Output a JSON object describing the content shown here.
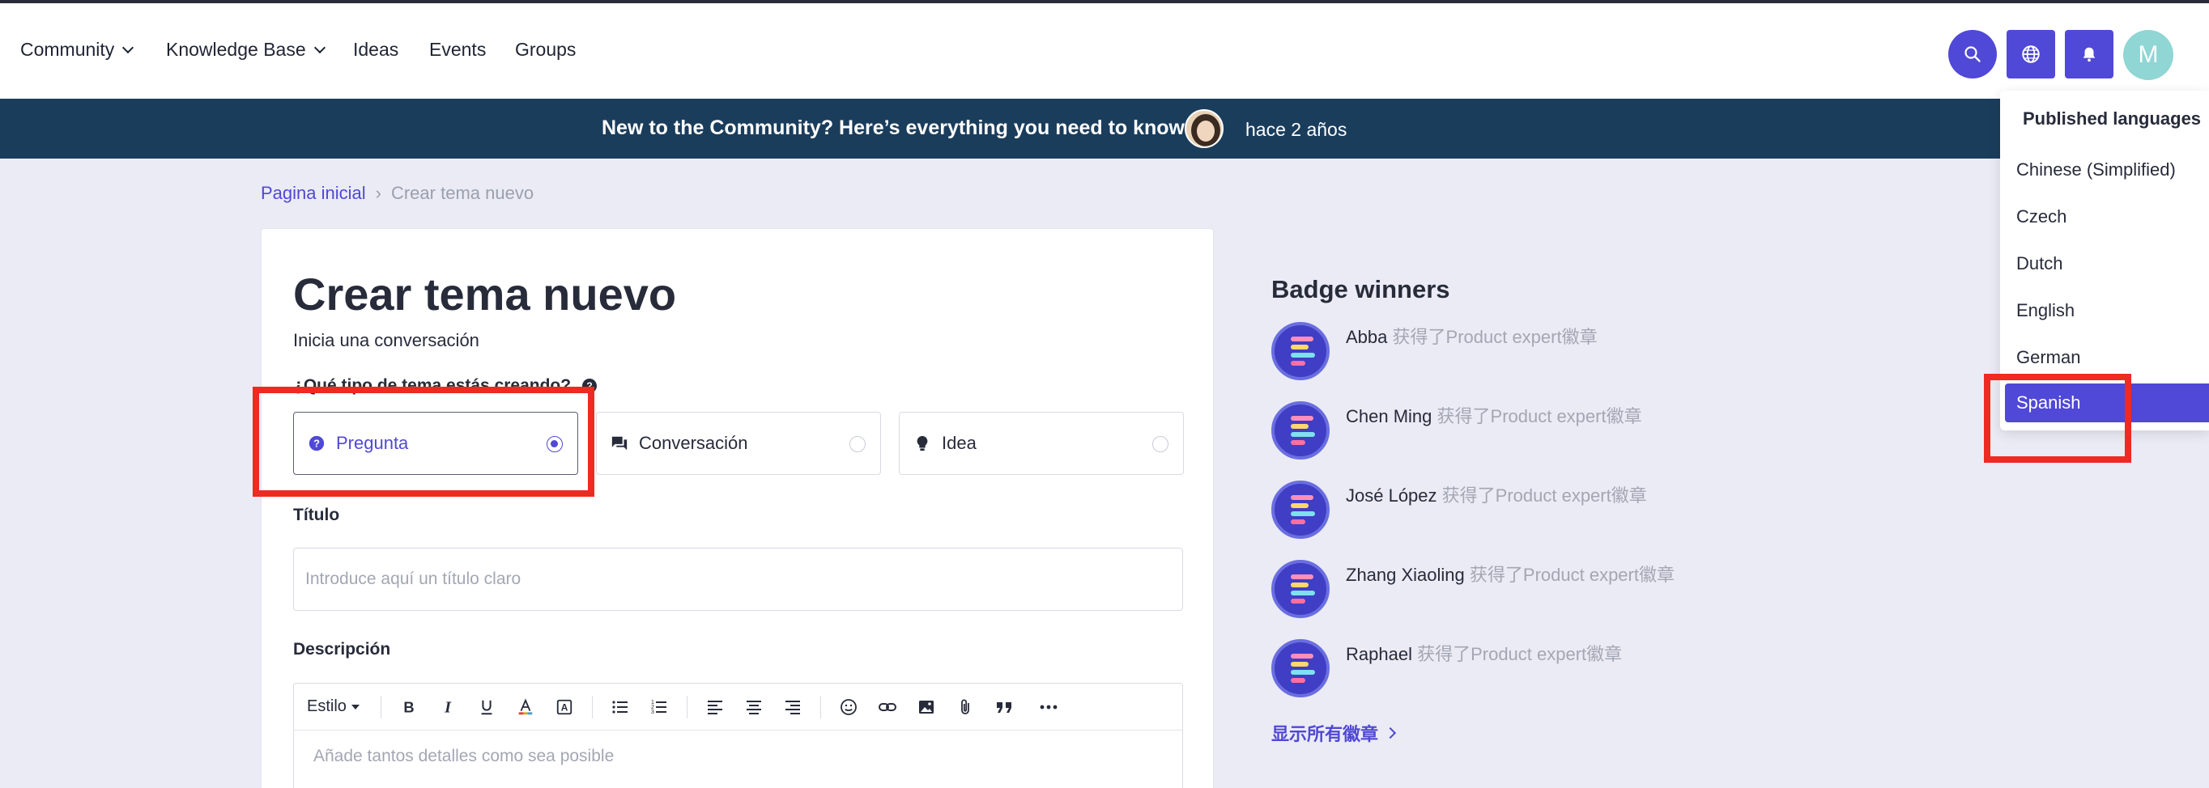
{
  "nav": {
    "items": [
      {
        "label": "Community",
        "dropdown": true
      },
      {
        "label": "Knowledge Base",
        "dropdown": true
      },
      {
        "label": "Ideas",
        "dropdown": false
      },
      {
        "label": "Events",
        "dropdown": false
      },
      {
        "label": "Groups",
        "dropdown": false
      }
    ],
    "avatar_initial": "M",
    "accent": "#5048d6"
  },
  "banner": {
    "text": "New to the Community? Here’s everything you need to know!",
    "time": "hace 2 años",
    "background": "#1b3d5c"
  },
  "breadcrumb": {
    "home": "Pagina inicial",
    "current": "Crear tema nuevo"
  },
  "form": {
    "title": "Crear tema nuevo",
    "subtitle": "Inicia una conversación",
    "type_question": "¿Qué tipo de tema estás creando?",
    "types": [
      {
        "label": "Pregunta",
        "icon": "question-circle-icon",
        "selected": true
      },
      {
        "label": "Conversación",
        "icon": "chat-icon",
        "selected": false
      },
      {
        "label": "Idea",
        "icon": "lightbulb-icon",
        "selected": false
      }
    ],
    "title_label": "Título",
    "title_placeholder": "Introduce aquí un título claro",
    "description_label": "Descripción",
    "style_label": "Estilo",
    "description_placeholder": "Añade tantos detalles como sea posible"
  },
  "badges": {
    "title": "Badge winners",
    "winners": [
      {
        "name": "Abba",
        "desc": "获得了Product expert徽章"
      },
      {
        "name": "Chen Ming",
        "desc": "获得了Product expert徽章"
      },
      {
        "name": "José López",
        "desc": "获得了Product expert徽章"
      },
      {
        "name": "Zhang Xiaoling",
        "desc": "获得了Product expert徽章"
      },
      {
        "name": "Raphael",
        "desc": "获得了Product expert徽章"
      }
    ],
    "show_all": "显示所有徽章"
  },
  "languages": {
    "title": "Published languages",
    "items": [
      {
        "label": "Chinese (Simplified)",
        "active": false
      },
      {
        "label": "Czech",
        "active": false
      },
      {
        "label": "Dutch",
        "active": false
      },
      {
        "label": "English",
        "active": false
      },
      {
        "label": "German",
        "active": false
      },
      {
        "label": "Spanish",
        "active": true
      }
    ]
  },
  "highlight_color": "#ee2a23"
}
